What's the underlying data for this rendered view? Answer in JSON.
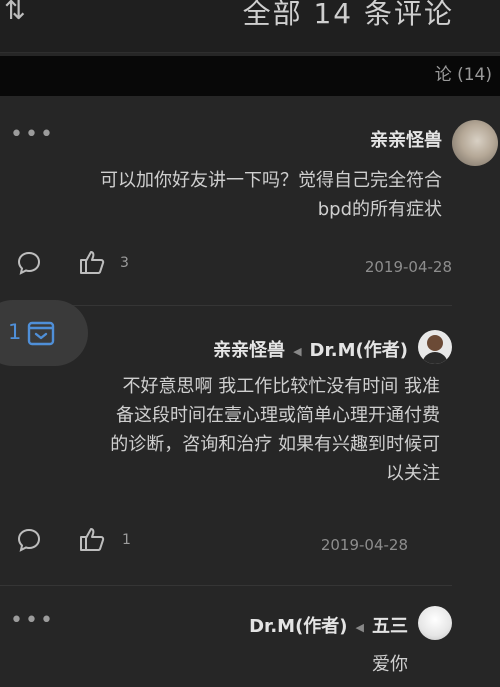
{
  "header": {
    "title": "全部 14 条评论",
    "menu_glyph": "⇅"
  },
  "subheader": {
    "text": "论 (14)"
  },
  "floating": {
    "count": "1"
  },
  "comments": [
    {
      "author": "亲亲怪兽",
      "body": [
        "可以加你好友讲一下吗？觉得自己完全符合",
        "bpd的所有症状"
      ],
      "date": "2019-04-28",
      "likes": "3",
      "more": "•••"
    },
    {
      "author": "Dr.M(作者)",
      "reply_to": "亲亲怪兽",
      "body": [
        "不好意思啊 我工作比较忙没有时间 我准",
        "备这段时间在壹心理或简单心理开通付费",
        "的诊断，咨询和治疗 如果有兴趣到时候可",
        "以关注"
      ],
      "date": "2019-04-28",
      "likes": "1",
      "more": ""
    },
    {
      "author": "五三",
      "reply_to": "Dr.M(作者)",
      "body": [
        "爱你"
      ],
      "more": "•••"
    }
  ],
  "colors": {
    "background": "#262626",
    "accent": "#4f8fd8"
  }
}
